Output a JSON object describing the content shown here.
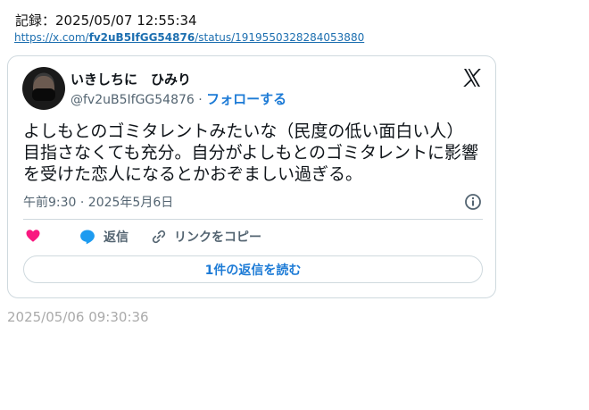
{
  "record": {
    "label": "記録：2025/05/07 12:55:34",
    "url_prefix": "https://x.com/",
    "url_user": "fv2uB5IfGG54876",
    "url_suffix": "/status/1919550328284053880"
  },
  "tweet": {
    "display_name": "いきしちに　ひみり",
    "handle": "@fv2uB5IfGG54876",
    "separator": " · ",
    "follow_label": "フォローする",
    "text": "よしもとのゴミタレントみたいな（民度の低い面白い人）目指さなくても充分。自分がよしもとのゴミタレントに影響を受けた恋人になるとかおぞましい過ぎる。",
    "timestamp": "午前9:30 · 2025年5月6日",
    "reply_label": "返信",
    "copy_link_label": "リンクをコピー",
    "read_replies_label": "1件の返信を読む"
  },
  "footer": {
    "captured_at": "2025/05/06 09:30:36"
  },
  "colors": {
    "like": "#f91880",
    "reply": "#1d9bf0",
    "link": "#1d6fb0",
    "follow": "#1d7bd6",
    "muted": "#536471",
    "border": "#cfd9de"
  },
  "icons": [
    "avatar-image",
    "x-logo-icon",
    "info-icon",
    "heart-icon",
    "reply-bubble-icon",
    "link-icon"
  ]
}
